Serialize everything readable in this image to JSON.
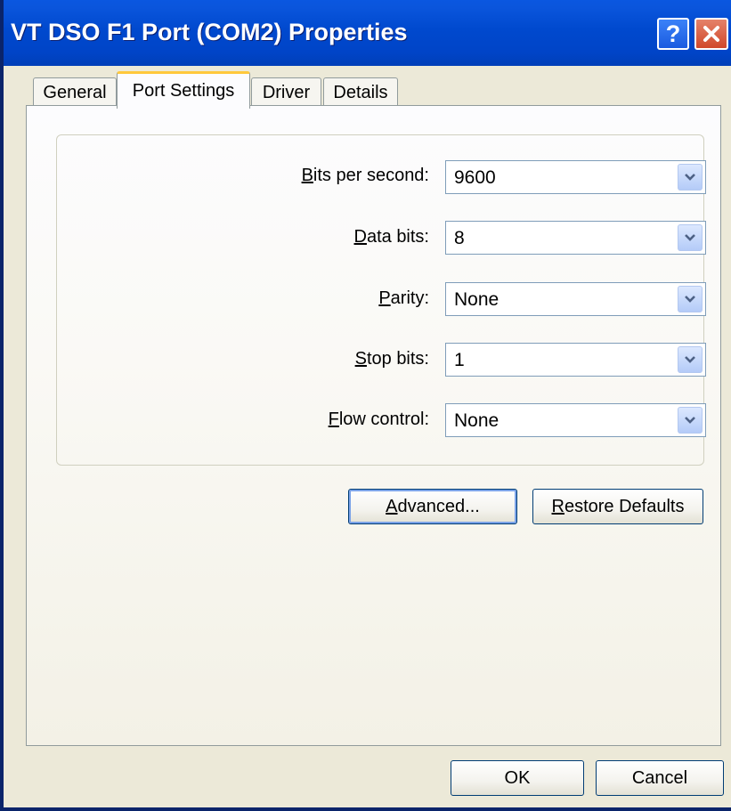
{
  "window": {
    "title": "VT DSO F1 Port (COM2) Properties"
  },
  "titlebar_buttons": {
    "help": "?",
    "help_icon": "help-icon",
    "close_icon": "close-icon"
  },
  "tabs": [
    {
      "label": "General",
      "active": false
    },
    {
      "label": "Port Settings",
      "active": true
    },
    {
      "label": "Driver",
      "active": false
    },
    {
      "label": "Details",
      "active": false
    }
  ],
  "settings": [
    {
      "label_first": "B",
      "label_rest": "its per second:",
      "value": "9600"
    },
    {
      "label_first": "D",
      "label_rest": "ata bits:",
      "value": "8"
    },
    {
      "label_first": "P",
      "label_rest": "arity:",
      "value": "None"
    },
    {
      "label_first": "S",
      "label_rest": "top bits:",
      "value": "1"
    },
    {
      "label_first": "F",
      "label_rest": "low control:",
      "value": "None"
    }
  ],
  "buttons": {
    "advanced_first": "A",
    "advanced_rest": "dvanced...",
    "restore_first": "R",
    "restore_rest": "estore Defaults",
    "ok": "OK",
    "cancel": "Cancel"
  },
  "colors": {
    "titlebar": "#0049CE",
    "face": "#ECE9D8",
    "tab_highlight": "#FFC83C",
    "button_border": "#003C74"
  }
}
